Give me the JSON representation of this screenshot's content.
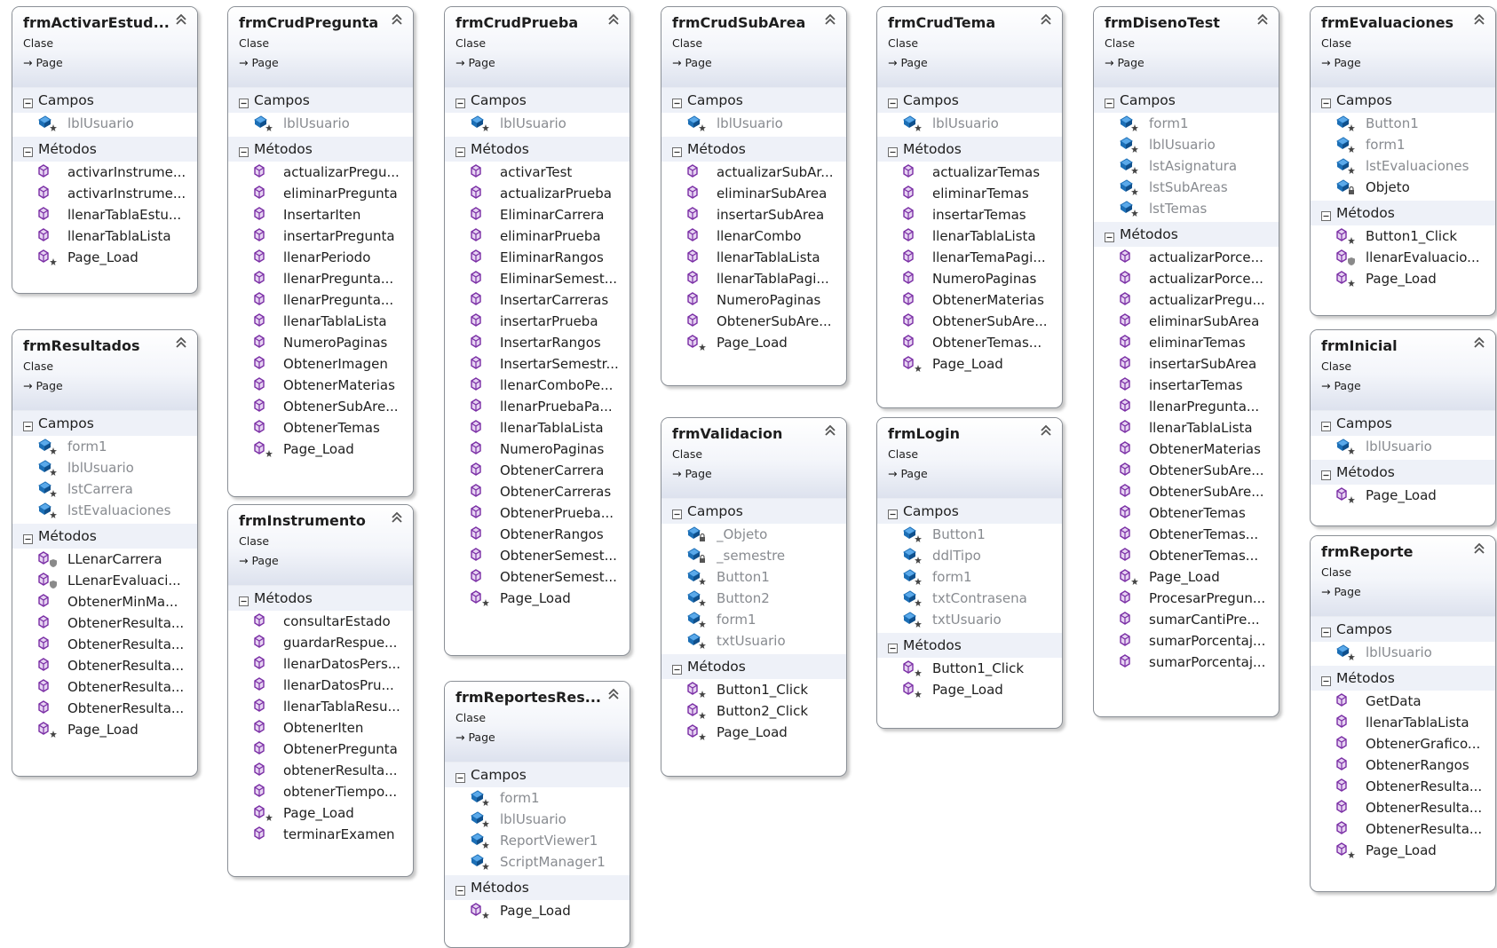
{
  "colors": {
    "member_text": "#1e1e1e",
    "field_text": "#888b90",
    "method_icon": "#7a2ea5",
    "field_icon": "#1c6fb6",
    "section_bg": "#eef1f8",
    "border": "#8a8f96"
  },
  "icons": {
    "collapse": "double-chevron-up-icon",
    "section": "minus-box-icon",
    "inherit": "arrow-right-icon",
    "field": "field-icon",
    "method": "method-icon",
    "private_field": "private-field-icon",
    "protected_method": "protected-method-icon"
  },
  "classes": [
    {
      "name": "frmActivarEstud...",
      "kind": "Clase",
      "base": "Page",
      "fields_label": "Campos",
      "fields": [
        {
          "name": "lblUsuario",
          "icon": "f"
        }
      ],
      "methods_label": "Métodos",
      "methods": [
        {
          "name": "activarInstrume...",
          "icon": "m"
        },
        {
          "name": "activarInstrume...",
          "icon": "m"
        },
        {
          "name": "llenarTablaEstu...",
          "icon": "m"
        },
        {
          "name": "llenarTablaLista",
          "icon": "m"
        },
        {
          "name": "Page_Load",
          "icon": "p"
        }
      ]
    },
    {
      "name": "frmResultados",
      "kind": "Clase",
      "base": "Page",
      "fields_label": "Campos",
      "fields": [
        {
          "name": "form1",
          "icon": "f"
        },
        {
          "name": "lblUsuario",
          "icon": "f"
        },
        {
          "name": "lstCarrera",
          "icon": "f"
        },
        {
          "name": "lstEvaluaciones",
          "icon": "f"
        }
      ],
      "methods_label": "Métodos",
      "methods": [
        {
          "name": "LLenarCarrera",
          "icon": "pl"
        },
        {
          "name": "LLenarEvaluaci...",
          "icon": "pl"
        },
        {
          "name": "ObtenerMinMa...",
          "icon": "m"
        },
        {
          "name": "ObtenerResulta...",
          "icon": "m"
        },
        {
          "name": "ObtenerResulta...",
          "icon": "m"
        },
        {
          "name": "ObtenerResulta...",
          "icon": "m"
        },
        {
          "name": "ObtenerResulta...",
          "icon": "m"
        },
        {
          "name": "ObtenerResulta...",
          "icon": "m"
        },
        {
          "name": "Page_Load",
          "icon": "p"
        }
      ]
    },
    {
      "name": "frmCrudPregunta",
      "kind": "Clase",
      "base": "Page",
      "fields_label": "Campos",
      "fields": [
        {
          "name": "lblUsuario",
          "icon": "f"
        }
      ],
      "methods_label": "Métodos",
      "methods": [
        {
          "name": "actualizarPregu...",
          "icon": "m"
        },
        {
          "name": "eliminarPregunta",
          "icon": "m"
        },
        {
          "name": "InsertarIten",
          "icon": "m"
        },
        {
          "name": "insertarPregunta",
          "icon": "m"
        },
        {
          "name": "llenarPeriodo",
          "icon": "m"
        },
        {
          "name": "llenarPregunta...",
          "icon": "m"
        },
        {
          "name": "llenarPregunta...",
          "icon": "m"
        },
        {
          "name": "llenarTablaLista",
          "icon": "m"
        },
        {
          "name": "NumeroPaginas",
          "icon": "m"
        },
        {
          "name": "ObtenerImagen",
          "icon": "m"
        },
        {
          "name": "ObtenerMaterias",
          "icon": "m"
        },
        {
          "name": "ObtenerSubAre...",
          "icon": "m"
        },
        {
          "name": "ObtenerTemas",
          "icon": "m"
        },
        {
          "name": "Page_Load",
          "icon": "p"
        }
      ]
    },
    {
      "name": "frmInstrumento",
      "kind": "Clase",
      "base": "Page",
      "fields_label": "",
      "fields": [],
      "methods_label": "Métodos",
      "methods": [
        {
          "name": "consultarEstado",
          "icon": "m"
        },
        {
          "name": "guardarRespue...",
          "icon": "m"
        },
        {
          "name": "llenarDatosPers...",
          "icon": "m"
        },
        {
          "name": "llenarDatosPru...",
          "icon": "m"
        },
        {
          "name": "llenarTablaResu...",
          "icon": "m"
        },
        {
          "name": "ObtenerIten",
          "icon": "m"
        },
        {
          "name": "ObtenerPregunta",
          "icon": "m"
        },
        {
          "name": "obtenerResulta...",
          "icon": "m"
        },
        {
          "name": "obtenerTiempo...",
          "icon": "m"
        },
        {
          "name": "Page_Load",
          "icon": "p"
        },
        {
          "name": "terminarExamen",
          "icon": "m"
        }
      ]
    },
    {
      "name": "frmCrudPrueba",
      "kind": "Clase",
      "base": "Page",
      "fields_label": "Campos",
      "fields": [
        {
          "name": "lblUsuario",
          "icon": "f"
        }
      ],
      "methods_label": "Métodos",
      "methods": [
        {
          "name": "activarTest",
          "icon": "m"
        },
        {
          "name": "actualizarPrueba",
          "icon": "m"
        },
        {
          "name": "EliminarCarrera",
          "icon": "m"
        },
        {
          "name": "eliminarPrueba",
          "icon": "m"
        },
        {
          "name": "EliminarRangos",
          "icon": "m"
        },
        {
          "name": "EliminarSemest...",
          "icon": "m"
        },
        {
          "name": "InsertarCarreras",
          "icon": "m"
        },
        {
          "name": "insertarPrueba",
          "icon": "m"
        },
        {
          "name": "InsertarRangos",
          "icon": "m"
        },
        {
          "name": "InsertarSemestr...",
          "icon": "m"
        },
        {
          "name": "llenarComboPe...",
          "icon": "m"
        },
        {
          "name": "llenarPruebaPa...",
          "icon": "m"
        },
        {
          "name": "llenarTablaLista",
          "icon": "m"
        },
        {
          "name": "NumeroPaginas",
          "icon": "m"
        },
        {
          "name": "ObtenerCarrera",
          "icon": "m"
        },
        {
          "name": "ObtenerCarreras",
          "icon": "m"
        },
        {
          "name": "ObtenerPrueba...",
          "icon": "m"
        },
        {
          "name": "ObtenerRangos",
          "icon": "m"
        },
        {
          "name": "ObtenerSemest...",
          "icon": "m"
        },
        {
          "name": "ObtenerSemest...",
          "icon": "m"
        },
        {
          "name": "Page_Load",
          "icon": "p"
        }
      ]
    },
    {
      "name": "frmReportesRes...",
      "kind": "Clase",
      "base": "Page",
      "fields_label": "Campos",
      "fields": [
        {
          "name": "form1",
          "icon": "f"
        },
        {
          "name": "lblUsuario",
          "icon": "f"
        },
        {
          "name": "ReportViewer1",
          "icon": "f"
        },
        {
          "name": "ScriptManager1",
          "icon": "f"
        }
      ],
      "methods_label": "Métodos",
      "methods": [
        {
          "name": "Page_Load",
          "icon": "p"
        }
      ]
    },
    {
      "name": "frmCrudSubArea",
      "kind": "Clase",
      "base": "Page",
      "fields_label": "Campos",
      "fields": [
        {
          "name": "lblUsuario",
          "icon": "f"
        }
      ],
      "methods_label": "Métodos",
      "methods": [
        {
          "name": "actualizarSubAr...",
          "icon": "m"
        },
        {
          "name": "eliminarSubArea",
          "icon": "m"
        },
        {
          "name": "insertarSubArea",
          "icon": "m"
        },
        {
          "name": "llenarCombo",
          "icon": "m"
        },
        {
          "name": "llenarTablaLista",
          "icon": "m"
        },
        {
          "name": "llenarTablaPagi...",
          "icon": "m"
        },
        {
          "name": "NumeroPaginas",
          "icon": "m"
        },
        {
          "name": "ObtenerSubAre...",
          "icon": "m"
        },
        {
          "name": "Page_Load",
          "icon": "p"
        }
      ]
    },
    {
      "name": "frmValidacion",
      "kind": "Clase",
      "base": "Page",
      "fields_label": "Campos",
      "fields": [
        {
          "name": "_Objeto",
          "icon": "fl"
        },
        {
          "name": "_semestre",
          "icon": "fl"
        },
        {
          "name": "Button1",
          "icon": "f"
        },
        {
          "name": "Button2",
          "icon": "f"
        },
        {
          "name": "form1",
          "icon": "f"
        },
        {
          "name": "txtUsuario",
          "icon": "f"
        }
      ],
      "methods_label": "Métodos",
      "methods": [
        {
          "name": "Button1_Click",
          "icon": "p"
        },
        {
          "name": "Button2_Click",
          "icon": "p"
        },
        {
          "name": "Page_Load",
          "icon": "p"
        }
      ]
    },
    {
      "name": "frmCrudTema",
      "kind": "Clase",
      "base": "Page",
      "fields_label": "Campos",
      "fields": [
        {
          "name": "lblUsuario",
          "icon": "f"
        }
      ],
      "methods_label": "Métodos",
      "methods": [
        {
          "name": "actualizarTemas",
          "icon": "m"
        },
        {
          "name": "eliminarTemas",
          "icon": "m"
        },
        {
          "name": "insertarTemas",
          "icon": "m"
        },
        {
          "name": "llenarTablaLista",
          "icon": "m"
        },
        {
          "name": "llenarTemaPagi...",
          "icon": "m"
        },
        {
          "name": "NumeroPaginas",
          "icon": "m"
        },
        {
          "name": "ObtenerMaterias",
          "icon": "m"
        },
        {
          "name": "ObtenerSubAre...",
          "icon": "m"
        },
        {
          "name": "ObtenerTemas...",
          "icon": "m"
        },
        {
          "name": "Page_Load",
          "icon": "p"
        }
      ]
    },
    {
      "name": "frmLogin",
      "kind": "Clase",
      "base": "Page",
      "fields_label": "Campos",
      "fields": [
        {
          "name": "Button1",
          "icon": "f"
        },
        {
          "name": "ddlTipo",
          "icon": "f"
        },
        {
          "name": "form1",
          "icon": "f"
        },
        {
          "name": "txtContrasena",
          "icon": "f"
        },
        {
          "name": "txtUsuario",
          "icon": "f"
        }
      ],
      "methods_label": "Métodos",
      "methods": [
        {
          "name": "Button1_Click",
          "icon": "p"
        },
        {
          "name": "Page_Load",
          "icon": "p"
        }
      ]
    },
    {
      "name": "frmDisenoTest",
      "kind": "Clase",
      "base": "Page",
      "fields_label": "Campos",
      "fields": [
        {
          "name": "form1",
          "icon": "f"
        },
        {
          "name": "lblUsuario",
          "icon": "f"
        },
        {
          "name": "lstAsignatura",
          "icon": "f"
        },
        {
          "name": "lstSubAreas",
          "icon": "f"
        },
        {
          "name": "lstTemas",
          "icon": "f"
        }
      ],
      "methods_label": "Métodos",
      "methods": [
        {
          "name": "actualizarPorce...",
          "icon": "m"
        },
        {
          "name": "actualizarPorce...",
          "icon": "m"
        },
        {
          "name": "actualizarPregu...",
          "icon": "m"
        },
        {
          "name": "eliminarSubArea",
          "icon": "m"
        },
        {
          "name": "eliminarTemas",
          "icon": "m"
        },
        {
          "name": "insertarSubArea",
          "icon": "m"
        },
        {
          "name": "insertarTemas",
          "icon": "m"
        },
        {
          "name": "llenarPregunta...",
          "icon": "m"
        },
        {
          "name": "llenarTablaLista",
          "icon": "m"
        },
        {
          "name": "ObtenerMaterias",
          "icon": "m"
        },
        {
          "name": "ObtenerSubAre...",
          "icon": "m"
        },
        {
          "name": "ObtenerSubAre...",
          "icon": "m"
        },
        {
          "name": "ObtenerTemas",
          "icon": "m"
        },
        {
          "name": "ObtenerTemas...",
          "icon": "m"
        },
        {
          "name": "ObtenerTemas...",
          "icon": "m"
        },
        {
          "name": "Page_Load",
          "icon": "p"
        },
        {
          "name": "ProcesarPregun...",
          "icon": "m"
        },
        {
          "name": "sumarCantiPre...",
          "icon": "m"
        },
        {
          "name": "sumarPorcentaj...",
          "icon": "m"
        },
        {
          "name": "sumarPorcentaj...",
          "icon": "m"
        }
      ]
    },
    {
      "name": "frmEvaluaciones",
      "kind": "Clase",
      "base": "Page",
      "fields_label": "Campos",
      "fields": [
        {
          "name": "Button1",
          "icon": "f"
        },
        {
          "name": "form1",
          "icon": "f"
        },
        {
          "name": "lstEvaluaciones",
          "icon": "f"
        },
        {
          "name": "Objeto",
          "icon": "fl",
          "plain": true
        }
      ],
      "methods_label": "Métodos",
      "methods": [
        {
          "name": "Button1_Click",
          "icon": "p"
        },
        {
          "name": "llenarEvaluacio...",
          "icon": "pl"
        },
        {
          "name": "Page_Load",
          "icon": "p"
        }
      ]
    },
    {
      "name": "frmInicial",
      "kind": "Clase",
      "base": "Page",
      "fields_label": "Campos",
      "fields": [
        {
          "name": "lblUsuario",
          "icon": "f"
        }
      ],
      "methods_label": "Métodos",
      "methods": [
        {
          "name": "Page_Load",
          "icon": "p"
        }
      ]
    },
    {
      "name": "frmReporte",
      "kind": "Clase",
      "base": "Page",
      "fields_label": "Campos",
      "fields": [
        {
          "name": "lblUsuario",
          "icon": "f"
        }
      ],
      "methods_label": "Métodos",
      "methods": [
        {
          "name": "GetData",
          "icon": "m"
        },
        {
          "name": "llenarTablaLista",
          "icon": "m"
        },
        {
          "name": "ObtenerGrafico...",
          "icon": "m"
        },
        {
          "name": "ObtenerRangos",
          "icon": "m"
        },
        {
          "name": "ObtenerResulta...",
          "icon": "m"
        },
        {
          "name": "ObtenerResulta...",
          "icon": "m"
        },
        {
          "name": "ObtenerResulta...",
          "icon": "m"
        },
        {
          "name": "Page_Load",
          "icon": "p"
        }
      ]
    }
  ]
}
